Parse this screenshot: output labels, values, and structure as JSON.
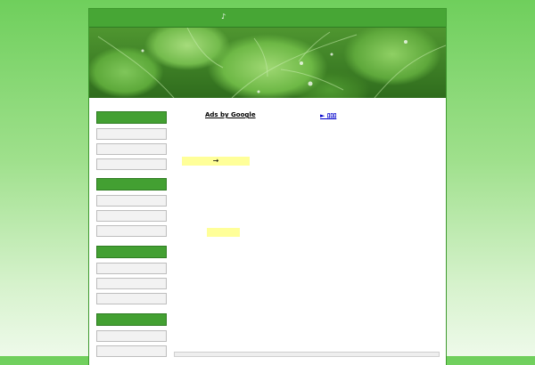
{
  "header": {
    "note_icon": "music-note-icon",
    "note_glyph": "♪"
  },
  "banner": {
    "image": "green-leaves-photo"
  },
  "sidebar": {
    "sections": [
      {
        "items": 3
      },
      {
        "items": 3
      },
      {
        "items": 3
      },
      {
        "items": 2
      }
    ]
  },
  "content": {
    "ads_label": "Ads by Google",
    "more_link": "► ﾛﾛﾛ",
    "arrow_box_text": "→",
    "yellow_box_2_text": ""
  },
  "colors": {
    "accent": "#47a635",
    "header_border": "#2f7d22",
    "highlight": "#ffff99",
    "link": "#0000cc"
  }
}
